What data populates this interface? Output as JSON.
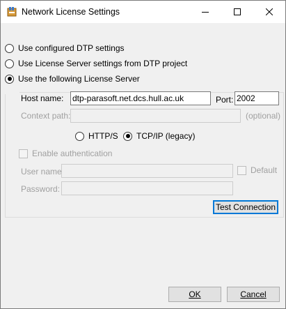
{
  "window": {
    "title": "Network License Settings"
  },
  "titlebar_buttons": {
    "minimize": "minimize-icon",
    "maximize": "maximize-icon",
    "close": "close-icon"
  },
  "options": [
    {
      "label": "Use configured DTP settings",
      "checked": false
    },
    {
      "label": "Use License Server settings from DTP project",
      "checked": false
    },
    {
      "label": "Use the following License Server",
      "checked": true
    }
  ],
  "server": {
    "host_label": "Host name:",
    "host_value": "dtp-parasoft.net.dcs.hull.ac.uk",
    "port_label": "Port:",
    "port_value": "2002",
    "context_label": "Context path:",
    "context_value": "",
    "optional_label": "(optional)",
    "protocols": [
      {
        "label": "HTTP/S",
        "checked": false
      },
      {
        "label": "TCP/IP (legacy)",
        "checked": true
      }
    ]
  },
  "auth": {
    "enable_label": "Enable authentication",
    "user_label": "User name:",
    "user_value": "",
    "default_label": "Default",
    "password_label": "Password:",
    "password_value": ""
  },
  "buttons": {
    "test_connection": "Test Connection",
    "ok": "OK",
    "cancel": "Cancel"
  }
}
